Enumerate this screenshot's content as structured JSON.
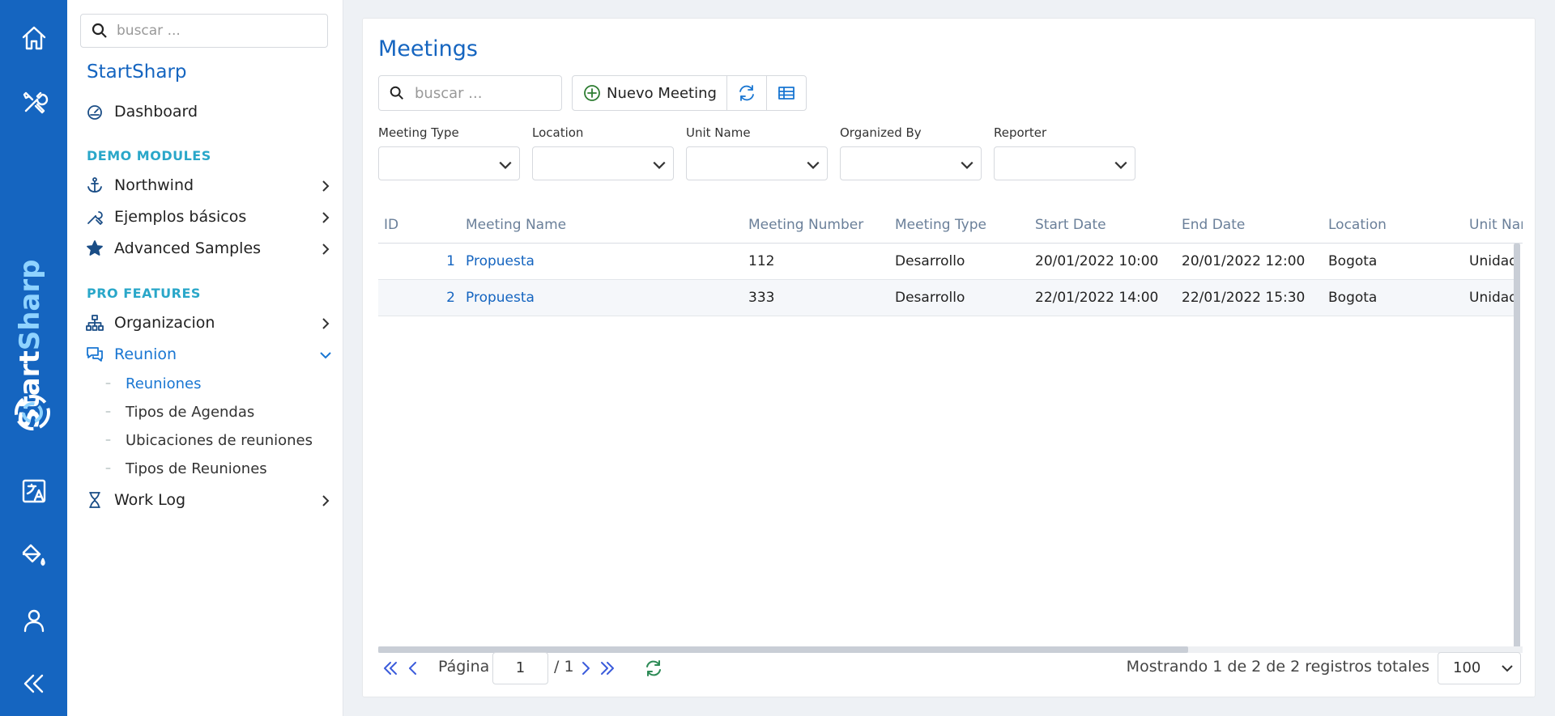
{
  "rail": {
    "brand_part1": "Start",
    "brand_part2": "Sharp",
    "icons": [
      "home-icon",
      "tools-icon",
      "translate-icon",
      "paint-bucket-icon",
      "user-icon",
      "collapse-icon"
    ]
  },
  "sidebar": {
    "search_placeholder": "buscar ...",
    "title": "StartSharp",
    "dashboard": "Dashboard",
    "section_demo": "DEMO MODULES",
    "northwind": "Northwind",
    "ejemplos": "Ejemplos básicos",
    "advanced": "Advanced Samples",
    "section_pro": "PRO FEATURES",
    "organizacion": "Organizacion",
    "reunion": "Reunion",
    "sub": [
      "Reuniones",
      "Tipos de Agendas",
      "Ubicaciones de reuniones",
      "Tipos de Reuniones"
    ],
    "worklog": "Work Log"
  },
  "main": {
    "title": "Meetings",
    "search_placeholder": "buscar ...",
    "new_button": "Nuevo Meeting",
    "filters": [
      "Meeting Type",
      "Location",
      "Unit Name",
      "Organized By",
      "Reporter"
    ],
    "columns": [
      "ID",
      "Meeting Name",
      "Meeting Number",
      "Meeting Type",
      "Start Date",
      "End Date",
      "Location",
      "Unit Nar"
    ],
    "rows": [
      {
        "id": "1",
        "name": "Propuesta",
        "number": "112",
        "type": "Desarrollo",
        "start": "20/01/2022 10:00",
        "end": "20/01/2022 12:00",
        "location": "Bogota",
        "unit": "Unidad"
      },
      {
        "id": "2",
        "name": "Propuesta",
        "number": "333",
        "type": "Desarrollo",
        "start": "22/01/2022 14:00",
        "end": "22/01/2022 15:30",
        "location": "Bogota",
        "unit": "Unidad"
      }
    ]
  },
  "pager": {
    "page_label": "Página",
    "page_value": "1",
    "page_total": "/ 1",
    "status": "Mostrando 1 de 2 de 2 registros totales",
    "page_size": "100"
  },
  "colors": {
    "rail": "#1565c0",
    "accent": "#1976d2",
    "section": "#2aa7c9",
    "add_icon": "#2e7d32"
  }
}
